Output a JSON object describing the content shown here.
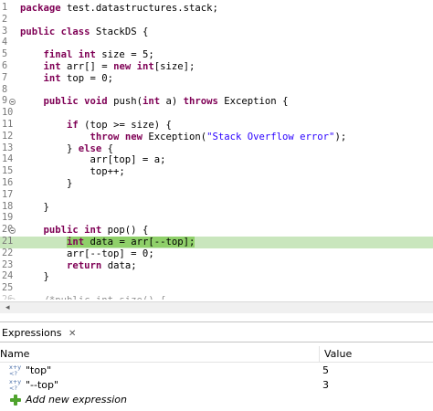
{
  "editor": {
    "lines": [
      {
        "n": "1",
        "fold": false,
        "current": false,
        "html": "<span class=\"kw\">package</span> test.datastructures.stack;"
      },
      {
        "n": "2",
        "fold": false,
        "current": false,
        "html": ""
      },
      {
        "n": "3",
        "fold": false,
        "current": false,
        "html": "<span class=\"kw\">public class</span> StackDS {"
      },
      {
        "n": "4",
        "fold": false,
        "current": false,
        "html": ""
      },
      {
        "n": "5",
        "fold": false,
        "current": false,
        "html": "    <span class=\"kw\">final int</span> size = 5;"
      },
      {
        "n": "6",
        "fold": false,
        "current": false,
        "html": "    <span class=\"kw\">int</span> arr[] = <span class=\"kw\">new int</span>[size];"
      },
      {
        "n": "7",
        "fold": false,
        "current": false,
        "html": "    <span class=\"kw\">int</span> top = 0;"
      },
      {
        "n": "8",
        "fold": false,
        "current": false,
        "html": ""
      },
      {
        "n": "9",
        "fold": true,
        "current": false,
        "html": "    <span class=\"kw\">public void</span> push(<span class=\"kw\">int</span> a) <span class=\"kw\">throws</span> Exception {"
      },
      {
        "n": "10",
        "fold": false,
        "current": false,
        "html": ""
      },
      {
        "n": "11",
        "fold": false,
        "current": false,
        "html": "        <span class=\"kw\">if</span> (top >= size) {"
      },
      {
        "n": "12",
        "fold": false,
        "current": false,
        "html": "            <span class=\"kw\">throw new</span> Exception(<span class=\"str\">\"Stack Overflow error\"</span>);"
      },
      {
        "n": "13",
        "fold": false,
        "current": false,
        "html": "        } <span class=\"kw\">else</span> {"
      },
      {
        "n": "14",
        "fold": false,
        "current": false,
        "html": "            arr[top] = a;"
      },
      {
        "n": "15",
        "fold": false,
        "current": false,
        "html": "            top++;"
      },
      {
        "n": "16",
        "fold": false,
        "current": false,
        "html": "        }"
      },
      {
        "n": "17",
        "fold": false,
        "current": false,
        "html": ""
      },
      {
        "n": "18",
        "fold": false,
        "current": false,
        "html": "    }"
      },
      {
        "n": "19",
        "fold": false,
        "current": false,
        "html": ""
      },
      {
        "n": "20",
        "fold": true,
        "current": false,
        "html": "    <span class=\"kw\">public int</span> pop() {"
      },
      {
        "n": "21",
        "fold": false,
        "current": true,
        "html": "        <span class=\"hl\"><span class=\"kw\">int</span> data = arr[--top];</span>"
      },
      {
        "n": "22",
        "fold": false,
        "current": false,
        "html": "        arr[--top] = 0;"
      },
      {
        "n": "23",
        "fold": false,
        "current": false,
        "html": "        <span class=\"kw\">return</span> data;"
      },
      {
        "n": "24",
        "fold": false,
        "current": false,
        "html": "    }"
      },
      {
        "n": "25",
        "fold": false,
        "current": false,
        "html": ""
      },
      {
        "n": "26",
        "fold": true,
        "current": false,
        "partial": true,
        "html": "    /*public int size() {"
      }
    ]
  },
  "hscroll": {
    "arrow_glyph": "◂"
  },
  "expressions": {
    "tab_label": "Expressions",
    "tab_close_glyph": "✕",
    "col_name": "Name",
    "col_value": "Value",
    "rows": [
      {
        "icon_top": "x+y",
        "icon_bottom": "<?",
        "name": "\"top\"",
        "value": "5"
      },
      {
        "icon_top": "x+y",
        "icon_bottom": "<?",
        "name": "\"--top\"",
        "value": "3"
      }
    ],
    "add_label": "Add new expression"
  }
}
